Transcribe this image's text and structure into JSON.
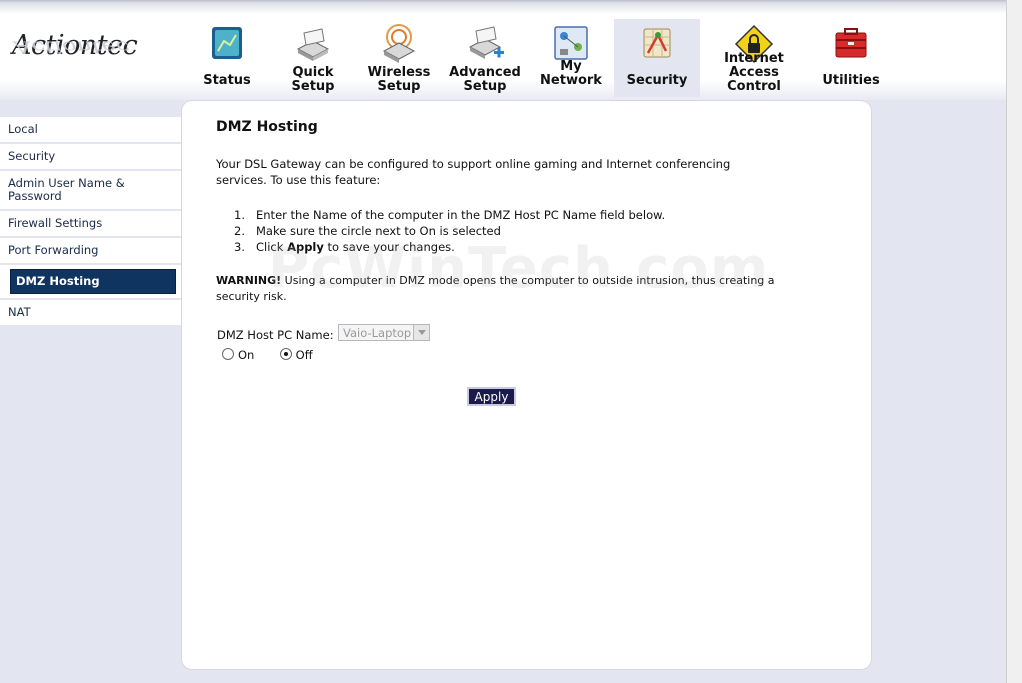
{
  "logo": {
    "text": "Actiontec",
    "reflection": "Actiontec"
  },
  "tabs": [
    {
      "label": "Status",
      "icon": "status-icon"
    },
    {
      "label": "Quick\nSetup",
      "icon": "quick-setup-icon"
    },
    {
      "label": "Wireless\nSetup",
      "icon": "wireless-setup-icon"
    },
    {
      "label": "Advanced\nSetup",
      "icon": "advanced-setup-icon"
    },
    {
      "label": "My Network",
      "icon": "my-network-icon"
    },
    {
      "label": "Security",
      "icon": "security-icon"
    },
    {
      "label": "Internet Access\nControl",
      "icon": "internet-access-control-icon"
    },
    {
      "label": "Utilities",
      "icon": "utilities-icon"
    }
  ],
  "sidebar": {
    "items": [
      {
        "label": "Local"
      },
      {
        "label": "Security"
      },
      {
        "label": "Admin User Name & Password"
      },
      {
        "label": "Firewall Settings"
      },
      {
        "label": "Port Forwarding"
      },
      {
        "label": "DMZ Hosting"
      },
      {
        "label": "NAT"
      }
    ]
  },
  "main": {
    "title": "DMZ Hosting",
    "intro": "Your DSL Gateway can be configured to support online gaming and Internet conferencing services. To use this feature:",
    "steps": [
      {
        "num": "1.",
        "text": "Enter the Name of the computer in the DMZ Host PC Name field below."
      },
      {
        "num": "2.",
        "text": "Make sure the circle next to On is selected"
      },
      {
        "num": "3.",
        "pre": "Click ",
        "bold": "Apply",
        "post": " to save your changes."
      }
    ],
    "warning_label": "WARNING!",
    "warning_text": " Using a computer in DMZ mode opens the computer to outside intrusion, thus creating a security risk.",
    "host_label": "DMZ Host PC Name:",
    "host_value": "Vaio-Laptop",
    "radio_on": "On",
    "radio_off": "Off",
    "selected_radio": "Off",
    "apply_label": "Apply"
  },
  "watermark": "PcWinTech.com",
  "colors": {
    "active_nav": "#0f3460",
    "apply_bg": "#1b1b4b",
    "page_bg": "#e3e6f1"
  }
}
